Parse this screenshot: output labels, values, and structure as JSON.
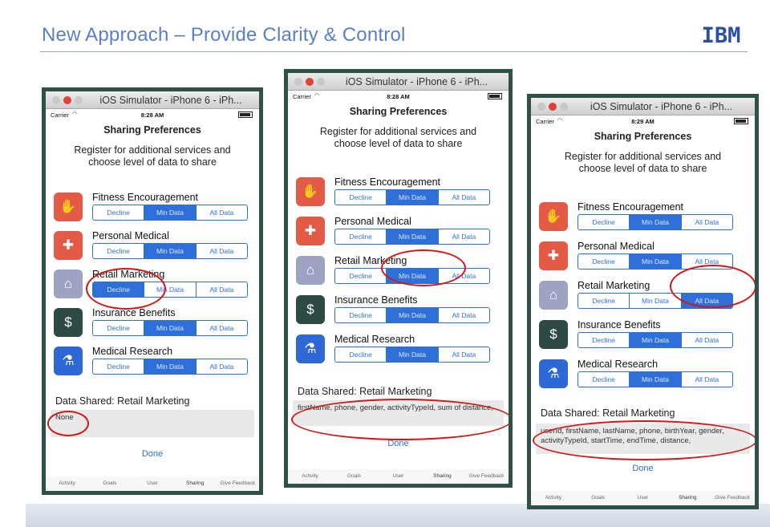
{
  "slide": {
    "title": "New Approach – Provide Clarity & Control",
    "logo_text": "IBM"
  },
  "simulators": [
    {
      "window_title": "iOS Simulator - iPhone 6 - iPh...",
      "status": {
        "carrier": "Carrier",
        "time": "8:28 AM"
      },
      "nav_title": "Sharing Preferences",
      "subtitle": [
        "Register for additional services and",
        "choose level of data to share"
      ],
      "categories": [
        {
          "name": "Fitness Encouragement",
          "icon": "hand-icon",
          "options": [
            "Decline",
            "Min Data",
            "All Data"
          ],
          "selected": "Min Data"
        },
        {
          "name": "Personal Medical",
          "icon": "first-aid-icon",
          "options": [
            "Decline",
            "Min Data",
            "All Data"
          ],
          "selected": "Min Data"
        },
        {
          "name": "Retail Marketing",
          "icon": "basket-icon",
          "options": [
            "Decline",
            "Min Data",
            "All Data"
          ],
          "selected": "Decline"
        },
        {
          "name": "Insurance Benefits",
          "icon": "shield-dollar-icon",
          "options": [
            "Decline",
            "Min Data",
            "All Data"
          ],
          "selected": "Min Data"
        },
        {
          "name": "Medical Research",
          "icon": "flask-icon",
          "options": [
            "Decline",
            "Min Data",
            "All Data"
          ],
          "selected": "Min Data"
        }
      ],
      "data_shared_label": "Data Shared: Retail Marketing",
      "data_shared_value": "None",
      "done_label": "Done",
      "tabs": [
        "Activity",
        "Goals",
        "User",
        "Sharing",
        "Give Feedback"
      ],
      "active_tab": "Sharing"
    },
    {
      "window_title": "iOS Simulator - iPhone 6 - iPh...",
      "status": {
        "carrier": "Carrier",
        "time": "8:28 AM"
      },
      "nav_title": "Sharing Preferences",
      "subtitle": [
        "Register for additional services and",
        "choose level of data to share"
      ],
      "categories": [
        {
          "name": "Fitness Encouragement",
          "icon": "hand-icon",
          "options": [
            "Decline",
            "Min Data",
            "All Data"
          ],
          "selected": "Min Data"
        },
        {
          "name": "Personal Medical",
          "icon": "first-aid-icon",
          "options": [
            "Decline",
            "Min Data",
            "All Data"
          ],
          "selected": "Min Data"
        },
        {
          "name": "Retail Marketing",
          "icon": "basket-icon",
          "options": [
            "Decline",
            "Min Data",
            "All Data"
          ],
          "selected": "Min Data"
        },
        {
          "name": "Insurance Benefits",
          "icon": "shield-dollar-icon",
          "options": [
            "Decline",
            "Min Data",
            "All Data"
          ],
          "selected": "Min Data"
        },
        {
          "name": "Medical Research",
          "icon": "flask-icon",
          "options": [
            "Decline",
            "Min Data",
            "All Data"
          ],
          "selected": "Min Data"
        }
      ],
      "data_shared_label": "Data Shared: Retail Marketing",
      "data_shared_value": "firstName, phone, gender, activityTypeId, sum of distance,",
      "done_label": "Done",
      "tabs": [
        "Activity",
        "Goals",
        "User",
        "Sharing",
        "Give Feedback"
      ],
      "active_tab": "Sharing"
    },
    {
      "window_title": "iOS Simulator - iPhone 6 - iPh...",
      "status": {
        "carrier": "Carrier",
        "time": "8:29 AM"
      },
      "nav_title": "Sharing Preferences",
      "subtitle": [
        "Register for additional services and",
        "choose level of data to share"
      ],
      "categories": [
        {
          "name": "Fitness Encouragement",
          "icon": "hand-icon",
          "options": [
            "Decline",
            "Min Data",
            "All Data"
          ],
          "selected": "Min Data"
        },
        {
          "name": "Personal Medical",
          "icon": "first-aid-icon",
          "options": [
            "Decline",
            "Min Data",
            "All Data"
          ],
          "selected": "Min Data"
        },
        {
          "name": "Retail Marketing",
          "icon": "basket-icon",
          "options": [
            "Decline",
            "Min Data",
            "All Data"
          ],
          "selected": "All Data"
        },
        {
          "name": "Insurance Benefits",
          "icon": "shield-dollar-icon",
          "options": [
            "Decline",
            "Min Data",
            "All Data"
          ],
          "selected": "Min Data"
        },
        {
          "name": "Medical Research",
          "icon": "flask-icon",
          "options": [
            "Decline",
            "Min Data",
            "All Data"
          ],
          "selected": "Min Data"
        }
      ],
      "data_shared_label": "Data Shared: Retail Marketing",
      "data_shared_value": "userId, firstName, lastName, phone, birthYear, gender, activityTypeId, startTime, endTime, distance,",
      "done_label": "Done",
      "tabs": [
        "Activity",
        "Goals",
        "User",
        "Sharing",
        "Give Feedback"
      ],
      "active_tab": "Sharing"
    }
  ],
  "colors": {
    "accent": "#2f6fd8",
    "annotation": "#d01818",
    "frame": "#30504a",
    "title": "#5b7fc4"
  }
}
